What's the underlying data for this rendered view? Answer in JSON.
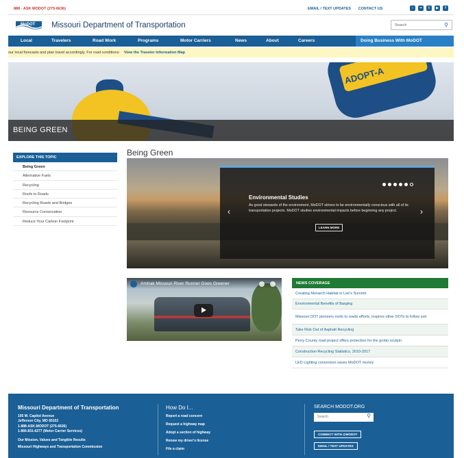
{
  "topbar": {
    "phone": "888 - ASK MODOT (275-6636)",
    "links": [
      "EMAIL / TEXT UPDATES",
      "CONTACT US"
    ],
    "social_icons": [
      "instagram-icon",
      "flickr-icon",
      "twitter-icon",
      "youtube-icon",
      "facebook-icon"
    ]
  },
  "header": {
    "logo_text": "MoDOT",
    "title": "Missouri Department of Transportation",
    "search_placeholder": "Search"
  },
  "nav": {
    "items": [
      "Local",
      "Travelers",
      "Road Work",
      "Programs",
      "Motor Carriers",
      "News",
      "About",
      "Careers"
    ],
    "cta": "Doing Business With MoDOT"
  },
  "alert": {
    "text": "our local forecasts and plan travel accordingly. For road conditions:",
    "link": "View the Traveler Information Map"
  },
  "hero": {
    "sign_text": "ADOPT-A",
    "caption": "BEING GREEN"
  },
  "sidebar": {
    "heading": "EXPLORE THIS TOPIC",
    "items": [
      "Being Green",
      "Alternative Fuels",
      "Recycling",
      "Roofs to Roads",
      "Recycling Roads and Bridges",
      "Resource Conservation",
      "Reduce Your Carbon Footprint"
    ]
  },
  "main": {
    "title": "Being Green",
    "slider": {
      "heading": "Environmental Studies",
      "body": "As good stewards of the environment, MoDOT strives to be environmentally conscious with all of its transportation projects. MoDOT studies environmental impacts before beginning any project.",
      "button": "LEARN MORE",
      "slide_count": 6,
      "active_slide": 6
    },
    "video": {
      "title": "Amtrak Missouri River Runner Goes Greener"
    }
  },
  "news": {
    "heading": "NEWS COVERAGE",
    "items": [
      "Creating Monarch Habitat in Lee's Summit",
      "Environmental Benefits of Barging",
      "Missouri DOT pioneers roofs to roads efforts, inspires other DOTs to follow suit",
      "Take Risk Out of Asphalt Recycling",
      "Perry County road project offers protection for the grotto sculpin",
      "Construction Recycling Statistics, 2010-2017",
      "LED Lighting conversion saves MoDOT money"
    ]
  },
  "footer": {
    "title": "Missouri Department of Transportation",
    "address": [
      "105 W. Capitol Avenue",
      "Jefferson City, MO 65102",
      "1-888-ASK-MODOT (275-6636)",
      "1-866-831-6277 (Motor Carrier Services)"
    ],
    "links": [
      "Our Mission, Values and Tangible Results",
      "Missouri Highways and Transportation Commission"
    ],
    "howdo_title": "How Do I...",
    "howdo_links": [
      "Report a road concern",
      "Request a highway map",
      "Adopt a section of highway",
      "Renew my driver's license",
      "File a claim"
    ],
    "search_title": "SEARCH MODOT.ORG",
    "search_placeholder": "Search",
    "buttons": [
      "CONNECT WITH @MODOT",
      "EMAIL / TEXT UPDATES"
    ]
  },
  "colors": {
    "brand_blue": "#1a5f96",
    "news_green": "#1e7a34",
    "alert_yellow": "#fdf7c3",
    "phone_red": "#c0392b"
  }
}
